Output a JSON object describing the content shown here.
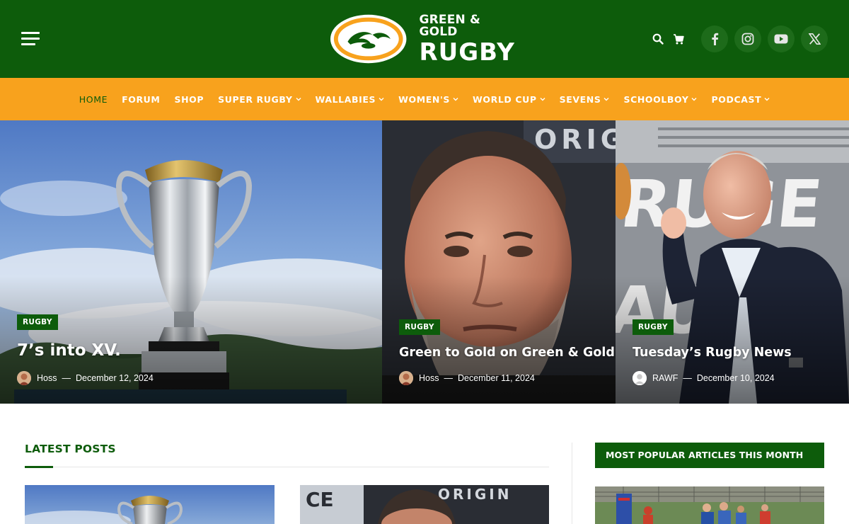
{
  "site": {
    "name_line1": "GREEN & GOLD",
    "name_line2": "RUGBY"
  },
  "colors": {
    "brand_green": "#0d5c0b",
    "brand_gold": "#f8a21d",
    "white": "#ffffff"
  },
  "header": {
    "menu_icon": "hamburger-menu-icon",
    "tools": [
      "search-icon",
      "cart-icon"
    ],
    "social": [
      "facebook-icon",
      "instagram-icon",
      "youtube-icon",
      "x-twitter-icon"
    ]
  },
  "nav": {
    "items": [
      {
        "label": "HOME",
        "active": true,
        "dropdown": false
      },
      {
        "label": "FORUM",
        "active": false,
        "dropdown": false
      },
      {
        "label": "SHOP",
        "active": false,
        "dropdown": false
      },
      {
        "label": "SUPER RUGBY",
        "active": false,
        "dropdown": true
      },
      {
        "label": "WALLABIES",
        "active": false,
        "dropdown": true
      },
      {
        "label": "WOMEN'S",
        "active": false,
        "dropdown": true
      },
      {
        "label": "WORLD CUP",
        "active": false,
        "dropdown": true
      },
      {
        "label": "SEVENS",
        "active": false,
        "dropdown": true
      },
      {
        "label": "SCHOOLBOY",
        "active": false,
        "dropdown": true
      },
      {
        "label": "PODCAST",
        "active": false,
        "dropdown": true
      }
    ]
  },
  "hero": {
    "posts": [
      {
        "category": "RUGBY",
        "title": "7’s into XV.",
        "author": "Hoss",
        "separator": "—",
        "date": "December 12, 2024"
      },
      {
        "category": "RUGBY",
        "title": "Green to Gold on Green & Gold.",
        "author": "Hoss",
        "separator": "—",
        "date": "December 11, 2024"
      },
      {
        "category": "RUGBY",
        "title": "Tuesday’s Rugby News",
        "author": "RAWF",
        "separator": "—",
        "date": "December 10, 2024"
      }
    ]
  },
  "latest": {
    "title": "LATEST POSTS",
    "thumb_text": "ORIGIN"
  },
  "sidebar": {
    "popular_title": "MOST POPULAR ARTICLES THIS MONTH"
  }
}
